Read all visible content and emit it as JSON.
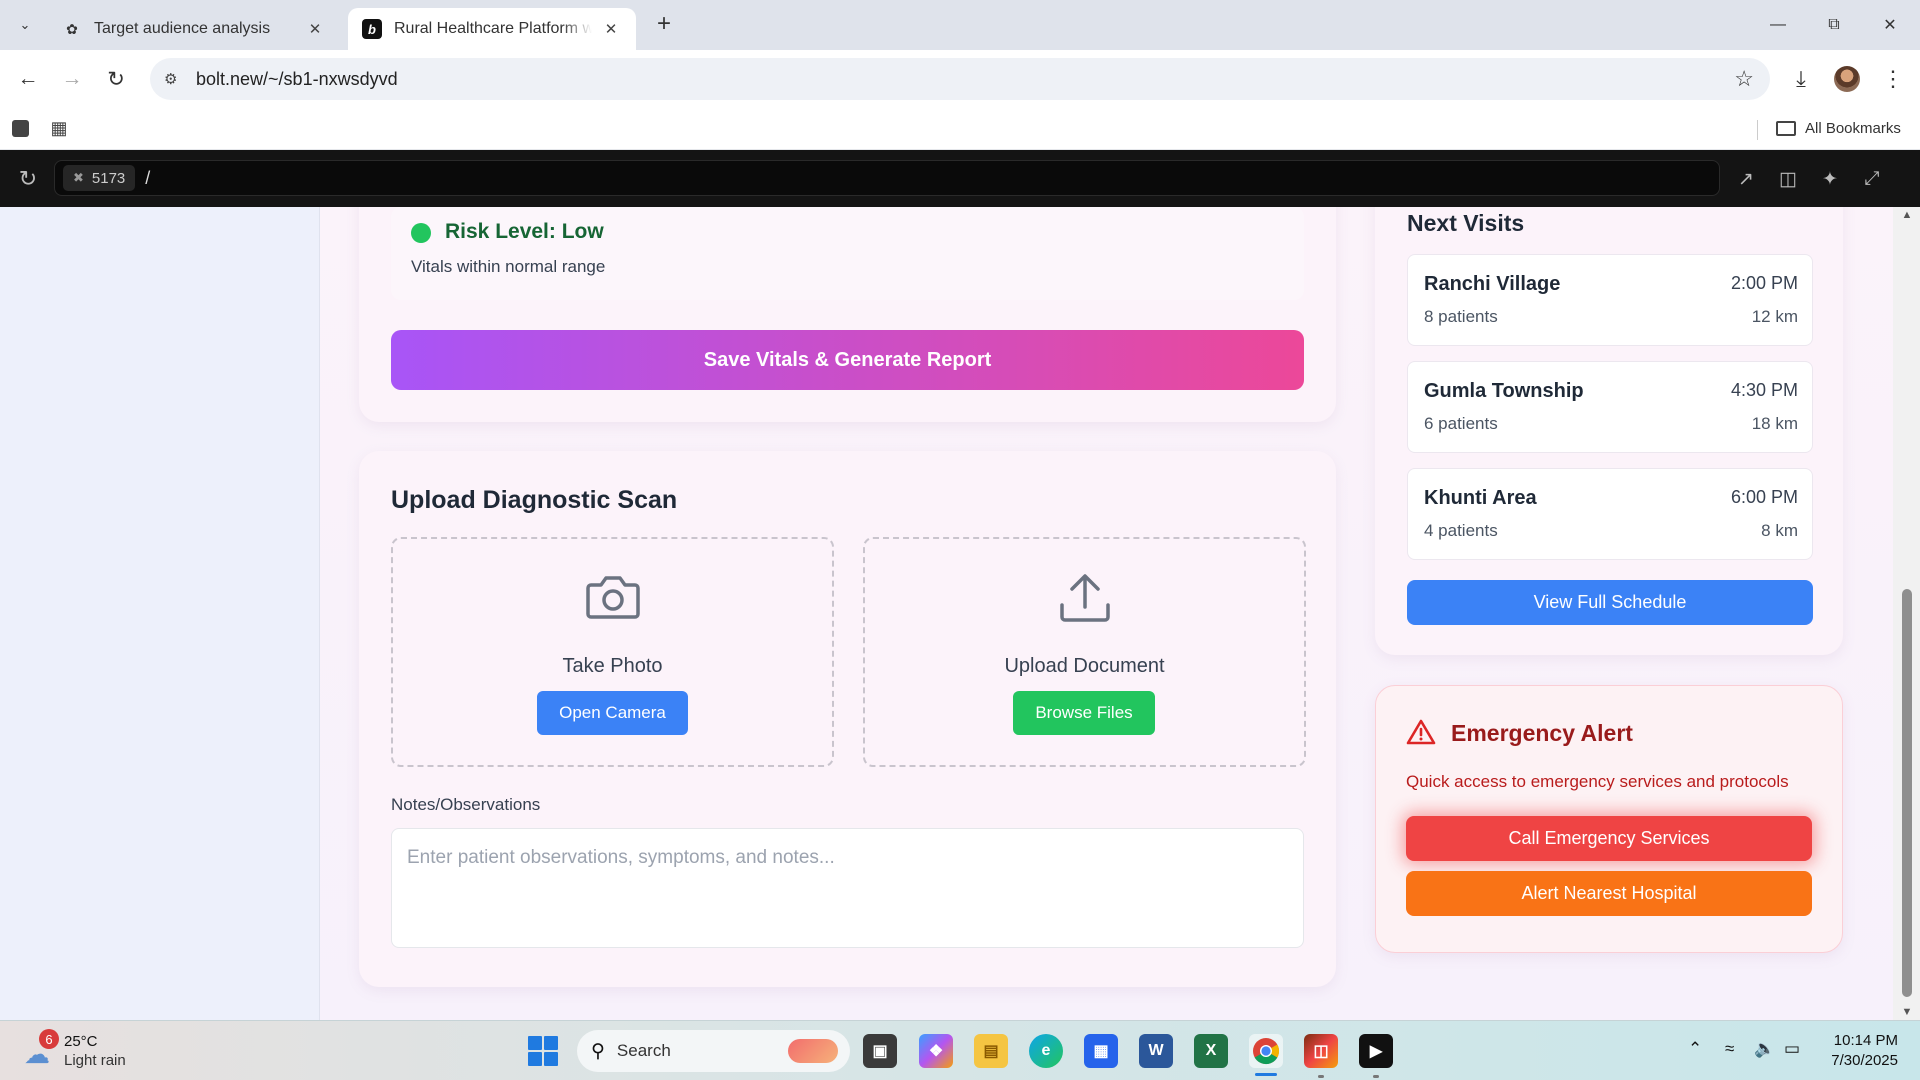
{
  "browser": {
    "tabs": [
      {
        "title": "Target audience analysis",
        "active": false
      },
      {
        "title": "Rural Healthcare Platform with",
        "active": true
      }
    ],
    "url": "bolt.new/~/sb1-nxwsdyvd",
    "bookmarks_label": "All Bookmarks"
  },
  "preview": {
    "port": "5173",
    "path": "/"
  },
  "vitals": {
    "risk_title": "Risk Level: Low",
    "risk_subtitle": "Vitals within normal range",
    "risk_color": "#22c55e",
    "save_button": "Save Vitals & Generate Report"
  },
  "upload": {
    "title": "Upload Diagnostic Scan",
    "photo_label": "Take Photo",
    "photo_button": "Open Camera",
    "document_label": "Upload Document",
    "document_button": "Browse Files",
    "notes_label": "Notes/Observations",
    "notes_placeholder": "Enter patient observations, symptoms, and notes...",
    "notes_value": ""
  },
  "visits": {
    "title": "Next Visits",
    "items": [
      {
        "place": "Ranchi Village",
        "time": "2:00 PM",
        "patients": "8 patients",
        "distance": "12 km"
      },
      {
        "place": "Gumla Township",
        "time": "4:30 PM",
        "patients": "6 patients",
        "distance": "18 km"
      },
      {
        "place": "Khunti Area",
        "time": "6:00 PM",
        "patients": "4 patients",
        "distance": "8 km"
      }
    ],
    "schedule_button": "View Full Schedule"
  },
  "emergency": {
    "title": "Emergency Alert",
    "description": "Quick access to emergency services and protocols",
    "call_button": "Call Emergency Services",
    "hospital_button": "Alert Nearest Hospital"
  },
  "taskbar": {
    "weather_badge": "6",
    "temperature": "25°C",
    "condition": "Light rain",
    "search_text": "Search",
    "time": "10:14 PM",
    "date": "7/30/2025"
  },
  "colors": {
    "primary_blue": "#3b82f6",
    "success_green": "#22c55e",
    "danger_red": "#ef4444",
    "warning_orange": "#f97316",
    "gradient_start": "#a855f7",
    "gradient_end": "#ec4899"
  }
}
